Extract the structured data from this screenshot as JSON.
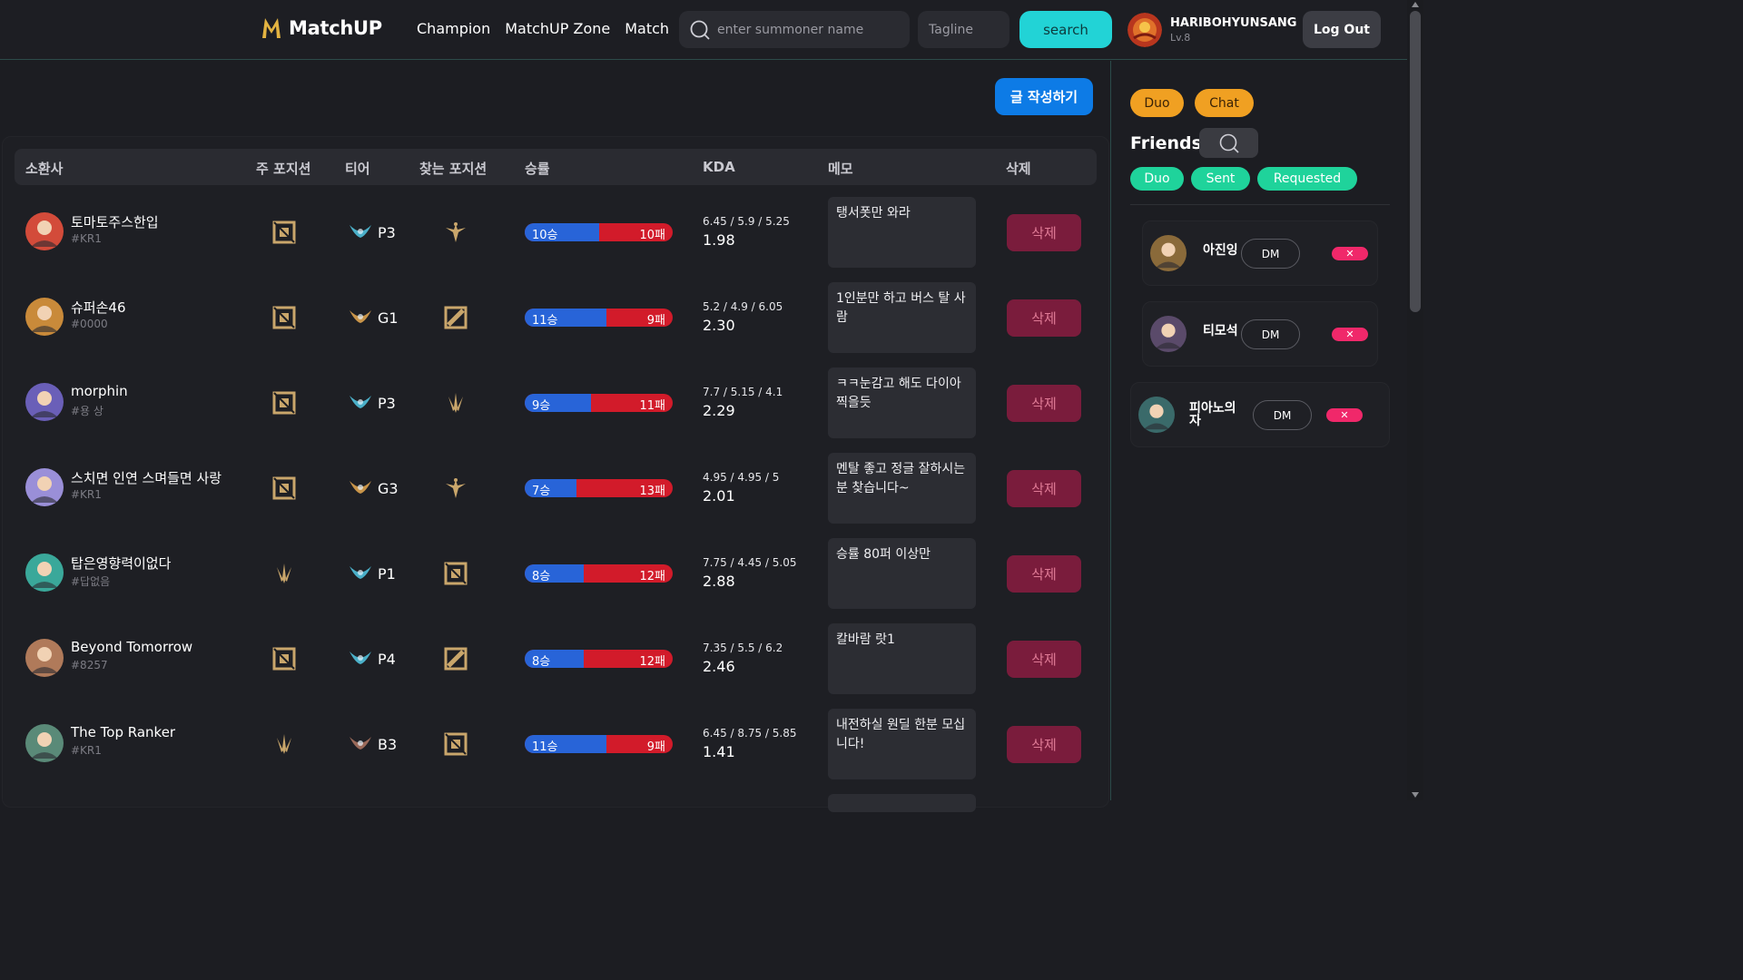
{
  "header": {
    "logo_text": "MatchUP",
    "nav": [
      "Champion",
      "MatchUP Zone",
      "Match"
    ],
    "search_placeholder": "enter summoner name",
    "tagline_placeholder": "Tagline",
    "search_label": "search",
    "profile": {
      "name": "HARIBOHYUNSANG",
      "level": "Lv.8"
    },
    "logout_label": "Log Out"
  },
  "main": {
    "write_label": "글 작성하기",
    "columns": [
      "소환사",
      "주 포지션",
      "티어",
      "찾는 포지션",
      "승률",
      "KDA",
      "메모",
      "삭제"
    ],
    "rows": [
      {
        "name": "토마토주스한입",
        "tag": "#KR1",
        "main_pos": "mid",
        "tier_icon": "platinum",
        "tier": "P3",
        "find_pos": "support",
        "wins": 10,
        "losses": 10,
        "win_label": "10승",
        "loss_label": "10패",
        "kda_line": "6.45 / 5.9 / 5.25",
        "kda": "1.98",
        "memo": "탱서폿만 와라",
        "delete_label": "삭제",
        "avatar": "#d34b3a"
      },
      {
        "name": "슈퍼손46",
        "tag": "#0000",
        "main_pos": "mid",
        "tier_icon": "gold",
        "tier": "G1",
        "find_pos": "jungle",
        "wins": 11,
        "losses": 9,
        "win_label": "11승",
        "loss_label": "9패",
        "kda_line": "5.2 / 4.9 / 6.05",
        "kda": "2.30",
        "memo": "1인분만 하고 버스 탈 사람",
        "delete_label": "삭제",
        "avatar": "#c98a3a"
      },
      {
        "name": "morphin",
        "tag": "#용 상",
        "main_pos": "mid",
        "tier_icon": "platinum",
        "tier": "P3",
        "find_pos": "top",
        "wins": 9,
        "losses": 11,
        "win_label": "9승",
        "loss_label": "11패",
        "kda_line": "7.7 / 5.15 / 4.1",
        "kda": "2.29",
        "memo": "ㅋㅋ눈감고 해도 다이아 찍을듯",
        "delete_label": "삭제",
        "avatar": "#6a5fb8"
      },
      {
        "name": "스치면 인연 스며들면 사랑",
        "tag": "#KR1",
        "main_pos": "mid",
        "tier_icon": "gold",
        "tier": "G3",
        "find_pos": "support",
        "wins": 7,
        "losses": 13,
        "win_label": "7승",
        "loss_label": "13패",
        "kda_line": "4.95 / 4.95 / 5",
        "kda": "2.01",
        "memo": "멘탈 좋고 정글 잘하시는 분 찾습니다~",
        "delete_label": "삭제",
        "avatar": "#9a8fd8"
      },
      {
        "name": "탑은영향력이없다",
        "tag": "#답없음",
        "main_pos": "top",
        "tier_icon": "platinum",
        "tier": "P1",
        "find_pos": "mid",
        "wins": 8,
        "losses": 12,
        "win_label": "8승",
        "loss_label": "12패",
        "kda_line": "7.75 / 4.45 / 5.05",
        "kda": "2.88",
        "memo": "승률 80퍼 이상만",
        "delete_label": "삭제",
        "avatar": "#3aa89a"
      },
      {
        "name": "Beyond Tomorrow",
        "tag": "#8257",
        "main_pos": "mid",
        "tier_icon": "platinum",
        "tier": "P4",
        "find_pos": "jungle",
        "wins": 8,
        "losses": 12,
        "win_label": "8승",
        "loss_label": "12패",
        "kda_line": "7.35 / 5.5 / 6.2",
        "kda": "2.46",
        "memo": "칼바람 랏1",
        "delete_label": "삭제",
        "avatar": "#b07a5a"
      },
      {
        "name": "The Top Ranker",
        "tag": "#KR1",
        "main_pos": "top",
        "tier_icon": "bronze",
        "tier": "B3",
        "find_pos": "mid",
        "wins": 11,
        "losses": 9,
        "win_label": "11승",
        "loss_label": "9패",
        "kda_line": "6.45 / 8.75 / 5.85",
        "kda": "1.41",
        "memo": "내전하실 원딜 한분 모십니다!",
        "delete_label": "삭제",
        "avatar": "#5a8a78"
      }
    ]
  },
  "sidebar": {
    "tabs_top": [
      "Duo",
      "Chat"
    ],
    "friends_title": "Friends",
    "tabs_filter": [
      "Duo",
      "Sent",
      "Requested"
    ],
    "friends": [
      {
        "name": "아진잉",
        "dm_label": "DM",
        "remove_label": "✕",
        "avatar": "#8a6a3a"
      },
      {
        "name": "티모석",
        "dm_label": "DM",
        "remove_label": "✕",
        "avatar": "#5a4a6a"
      },
      {
        "name": "피아노의 자",
        "dm_label": "DM",
        "remove_label": "✕",
        "avatar": "#3a6a6a"
      }
    ]
  },
  "colors": {
    "accent_cyan": "#22d3d6",
    "write_blue": "#0d7be6",
    "win_blue": "#2864d8",
    "loss_red": "#d21b2a",
    "delete_bg": "#7a1c3c",
    "orange_pill": "#f0a022",
    "teal_pill": "#1fd39b",
    "remove_pink": "#f0286a"
  }
}
